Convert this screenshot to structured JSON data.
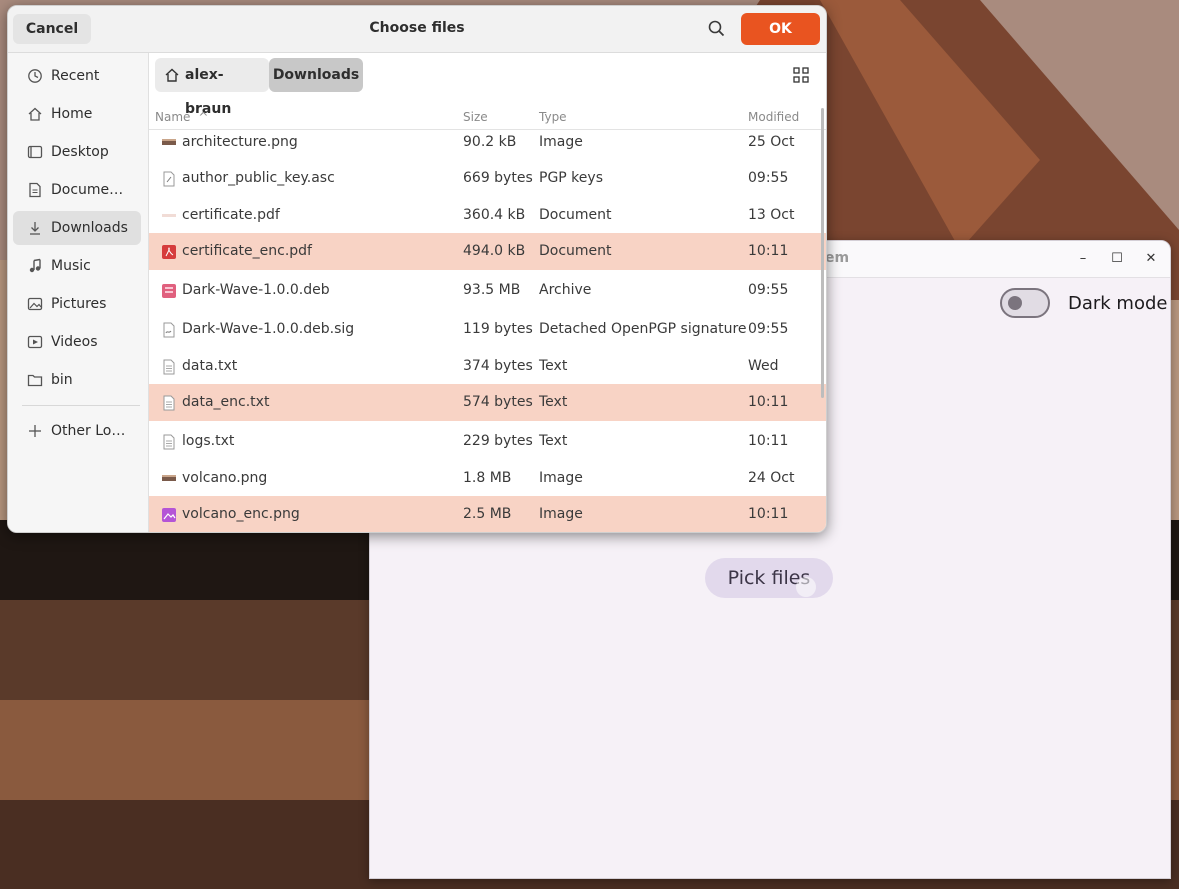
{
  "dialog": {
    "title": "Choose files",
    "cancel_label": "Cancel",
    "ok_label": "OK",
    "sidebar": [
      {
        "label": "Recent",
        "icon": "clock-icon"
      },
      {
        "label": "Home",
        "icon": "home-icon"
      },
      {
        "label": "Desktop",
        "icon": "desktop-icon"
      },
      {
        "label": "Docume…",
        "icon": "document-icon"
      },
      {
        "label": "Downloads",
        "icon": "download-icon",
        "active": true
      },
      {
        "label": "Music",
        "icon": "music-icon"
      },
      {
        "label": "Pictures",
        "icon": "pictures-icon"
      },
      {
        "label": "Videos",
        "icon": "video-icon"
      },
      {
        "label": "bin",
        "icon": "folder-icon"
      },
      {
        "label": "Other Lo…",
        "icon": "plus-icon"
      }
    ],
    "path": {
      "home": "alex-braun",
      "current": "Downloads"
    },
    "columns": {
      "name": "Name",
      "size": "Size",
      "type": "Type",
      "modified": "Modified"
    },
    "files": [
      {
        "name": "architecture.png",
        "size": "90.2 kB",
        "type": "Image",
        "modified": "25 Oct",
        "selected": false,
        "icon": "image-thumb-icon"
      },
      {
        "name": "author_public_key.asc",
        "size": "669 bytes",
        "type": "PGP keys",
        "modified": "09:55",
        "selected": false,
        "icon": "key-file-icon"
      },
      {
        "name": "certificate.pdf",
        "size": "360.4 kB",
        "type": "Document",
        "modified": "13 Oct",
        "selected": false,
        "icon": "pdf-thumb-icon"
      },
      {
        "name": "certificate_enc.pdf",
        "size": "494.0 kB",
        "type": "Document",
        "modified": "10:11",
        "selected": true,
        "icon": "pdf-icon"
      },
      {
        "name": "Dark-Wave-1.0.0.deb",
        "size": "93.5 MB",
        "type": "Archive",
        "modified": "09:55",
        "selected": false,
        "icon": "archive-icon"
      },
      {
        "name": "Dark-Wave-1.0.0.deb.sig",
        "size": "119 bytes",
        "type": "Detached OpenPGP signature",
        "modified": "09:55",
        "selected": false,
        "icon": "signature-file-icon"
      },
      {
        "name": "data.txt",
        "size": "374 bytes",
        "type": "Text",
        "modified": "Wed",
        "selected": false,
        "icon": "text-file-icon"
      },
      {
        "name": "data_enc.txt",
        "size": "574 bytes",
        "type": "Text",
        "modified": "10:11",
        "selected": true,
        "icon": "text-file-icon"
      },
      {
        "name": "logs.txt",
        "size": "229 bytes",
        "type": "Text",
        "modified": "10:11",
        "selected": false,
        "icon": "text-file-icon"
      },
      {
        "name": "volcano.png",
        "size": "1.8 MB",
        "type": "Image",
        "modified": "24 Oct",
        "selected": false,
        "icon": "image-thumb-icon"
      },
      {
        "name": "volcano_enc.png",
        "size": "2.5 MB",
        "type": "Image",
        "modified": "10:11",
        "selected": true,
        "icon": "image-icon"
      }
    ]
  },
  "app": {
    "title_fragment": "em",
    "dark_mode_label": "Dark mode",
    "dark_mode_on": false,
    "pick_button_label": "Pick files"
  },
  "colors": {
    "accent": "#e95420",
    "selection": "#f8d3c5"
  }
}
